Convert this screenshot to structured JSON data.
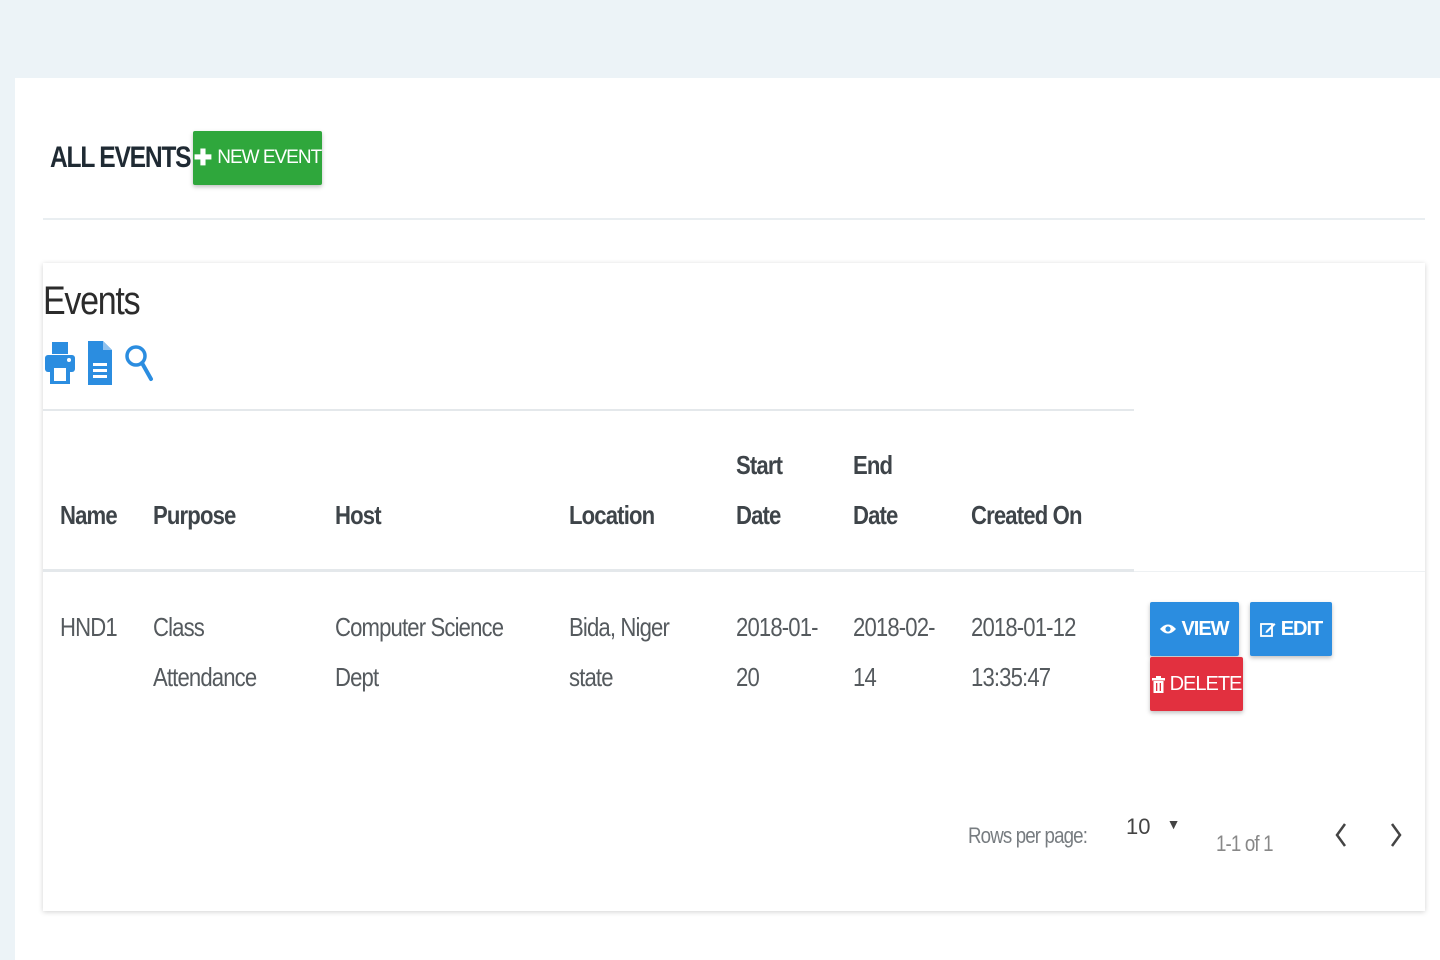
{
  "page": {
    "title": "ALL EVENTS",
    "new_event_label": "NEW EVENT"
  },
  "table": {
    "title": "Events",
    "toolbar": [
      {
        "icon": "print-icon"
      },
      {
        "icon": "file-icon"
      },
      {
        "icon": "search-icon"
      }
    ],
    "columns": {
      "name": "Name",
      "purpose": "Purpose",
      "host": "Host",
      "location": "Location",
      "start_date_1": "Start",
      "start_date_2": "Date",
      "end_date_1": "End",
      "end_date_2": "Date",
      "created_on": "Created On"
    },
    "rows": [
      {
        "name": "HND1",
        "purpose_1": "Class",
        "purpose_2": "Attendance",
        "host_1": "Computer Science",
        "host_2": "Dept",
        "location_1": "Bida, Niger",
        "location_2": "state",
        "start_1": "2018-01-",
        "start_2": "20",
        "end_1": "2018-02-",
        "end_2": "14",
        "created_1": "2018-01-12",
        "created_2": "13:35:47",
        "actions": {
          "view": "VIEW",
          "edit": "EDIT",
          "delete": "DELETE"
        }
      }
    ],
    "footer": {
      "rows_per_page_label": "Rows per page:",
      "rows_per_page_value": "10",
      "range": "1-1 of 1"
    }
  },
  "colors": {
    "primary": "#2b8de0",
    "success": "#2fa73c",
    "danger": "#e2303f",
    "background": "#ecf3f7"
  }
}
